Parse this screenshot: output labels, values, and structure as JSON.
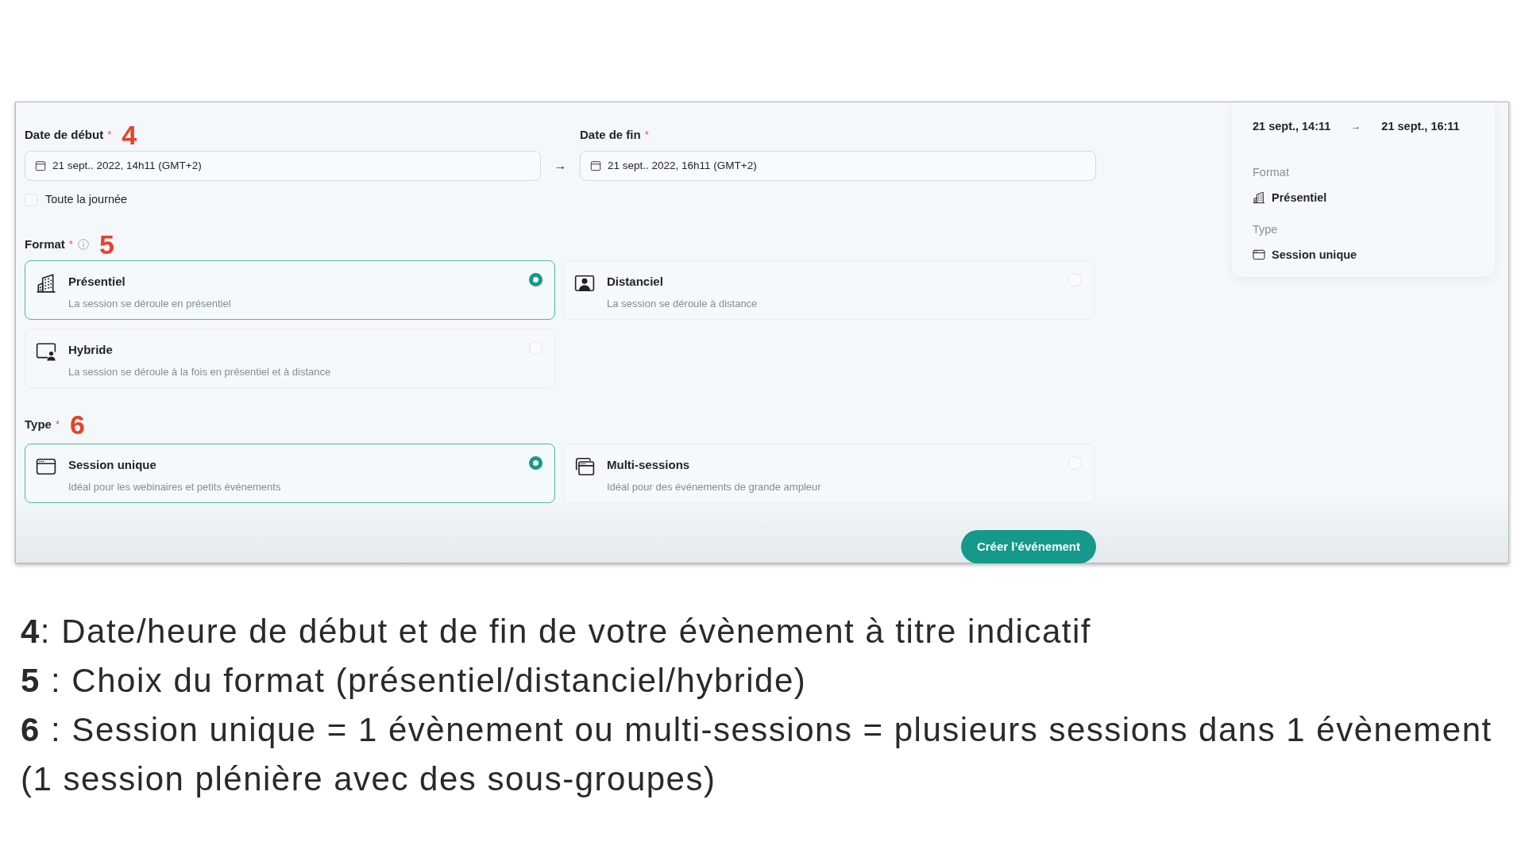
{
  "form": {
    "dates": {
      "start": {
        "label": "Date de début",
        "required_mark": "*",
        "annotation": "4",
        "value": "21 sept.. 2022, 14h11 (GMT+2)"
      },
      "arrow": "→",
      "end": {
        "label": "Date de fin",
        "required_mark": "*",
        "value": "21 sept.. 2022, 16h11 (GMT+2)"
      }
    },
    "all_day": {
      "label": "Toute la journée",
      "checked": false
    },
    "groups": [
      {
        "label": "Format",
        "required_mark": "*",
        "info": true,
        "annotation": "5",
        "options": [
          {
            "kind": "building",
            "title": "Présentiel",
            "description": "La session se déroule en présentiel",
            "selected": true
          },
          {
            "kind": "person-frame",
            "title": "Distanciel",
            "description": "La session se déroule à distance",
            "selected": false
          },
          {
            "kind": "screen-person",
            "title": "Hybride",
            "description": "La session se déroule à la fois en présentiel et à distance",
            "selected": false
          }
        ]
      },
      {
        "label": "Type",
        "required_mark": "*",
        "info": false,
        "annotation": "6",
        "options": [
          {
            "kind": "window",
            "title": "Session unique",
            "description": "Idéal pour les webinaires et petits événements",
            "selected": true
          },
          {
            "kind": "windows",
            "title": "Multi-sessions",
            "description": "Idéal pour des événements de grande ampleur",
            "selected": false
          }
        ]
      }
    ],
    "submit": "Créer l’événement"
  },
  "summary": {
    "start": "21 sept., 14:11",
    "arrow": "→",
    "end": "21 sept., 16:11",
    "fields": [
      {
        "label": "Format",
        "kind": "building",
        "value": "Présentiel"
      },
      {
        "label": "Type",
        "kind": "window",
        "value": "Session unique"
      }
    ]
  },
  "notes": [
    "**4**: Date/heure de début et de fin de votre évènement à titre indicatif",
    "**5** : Choix du format (présentiel/distanciel/hybride)",
    "**6** : Session unique = 1 évènement ou multi-sessions = plusieurs sessions dans 1 évènement (1 session plénière avec des sous-groupes)"
  ]
}
